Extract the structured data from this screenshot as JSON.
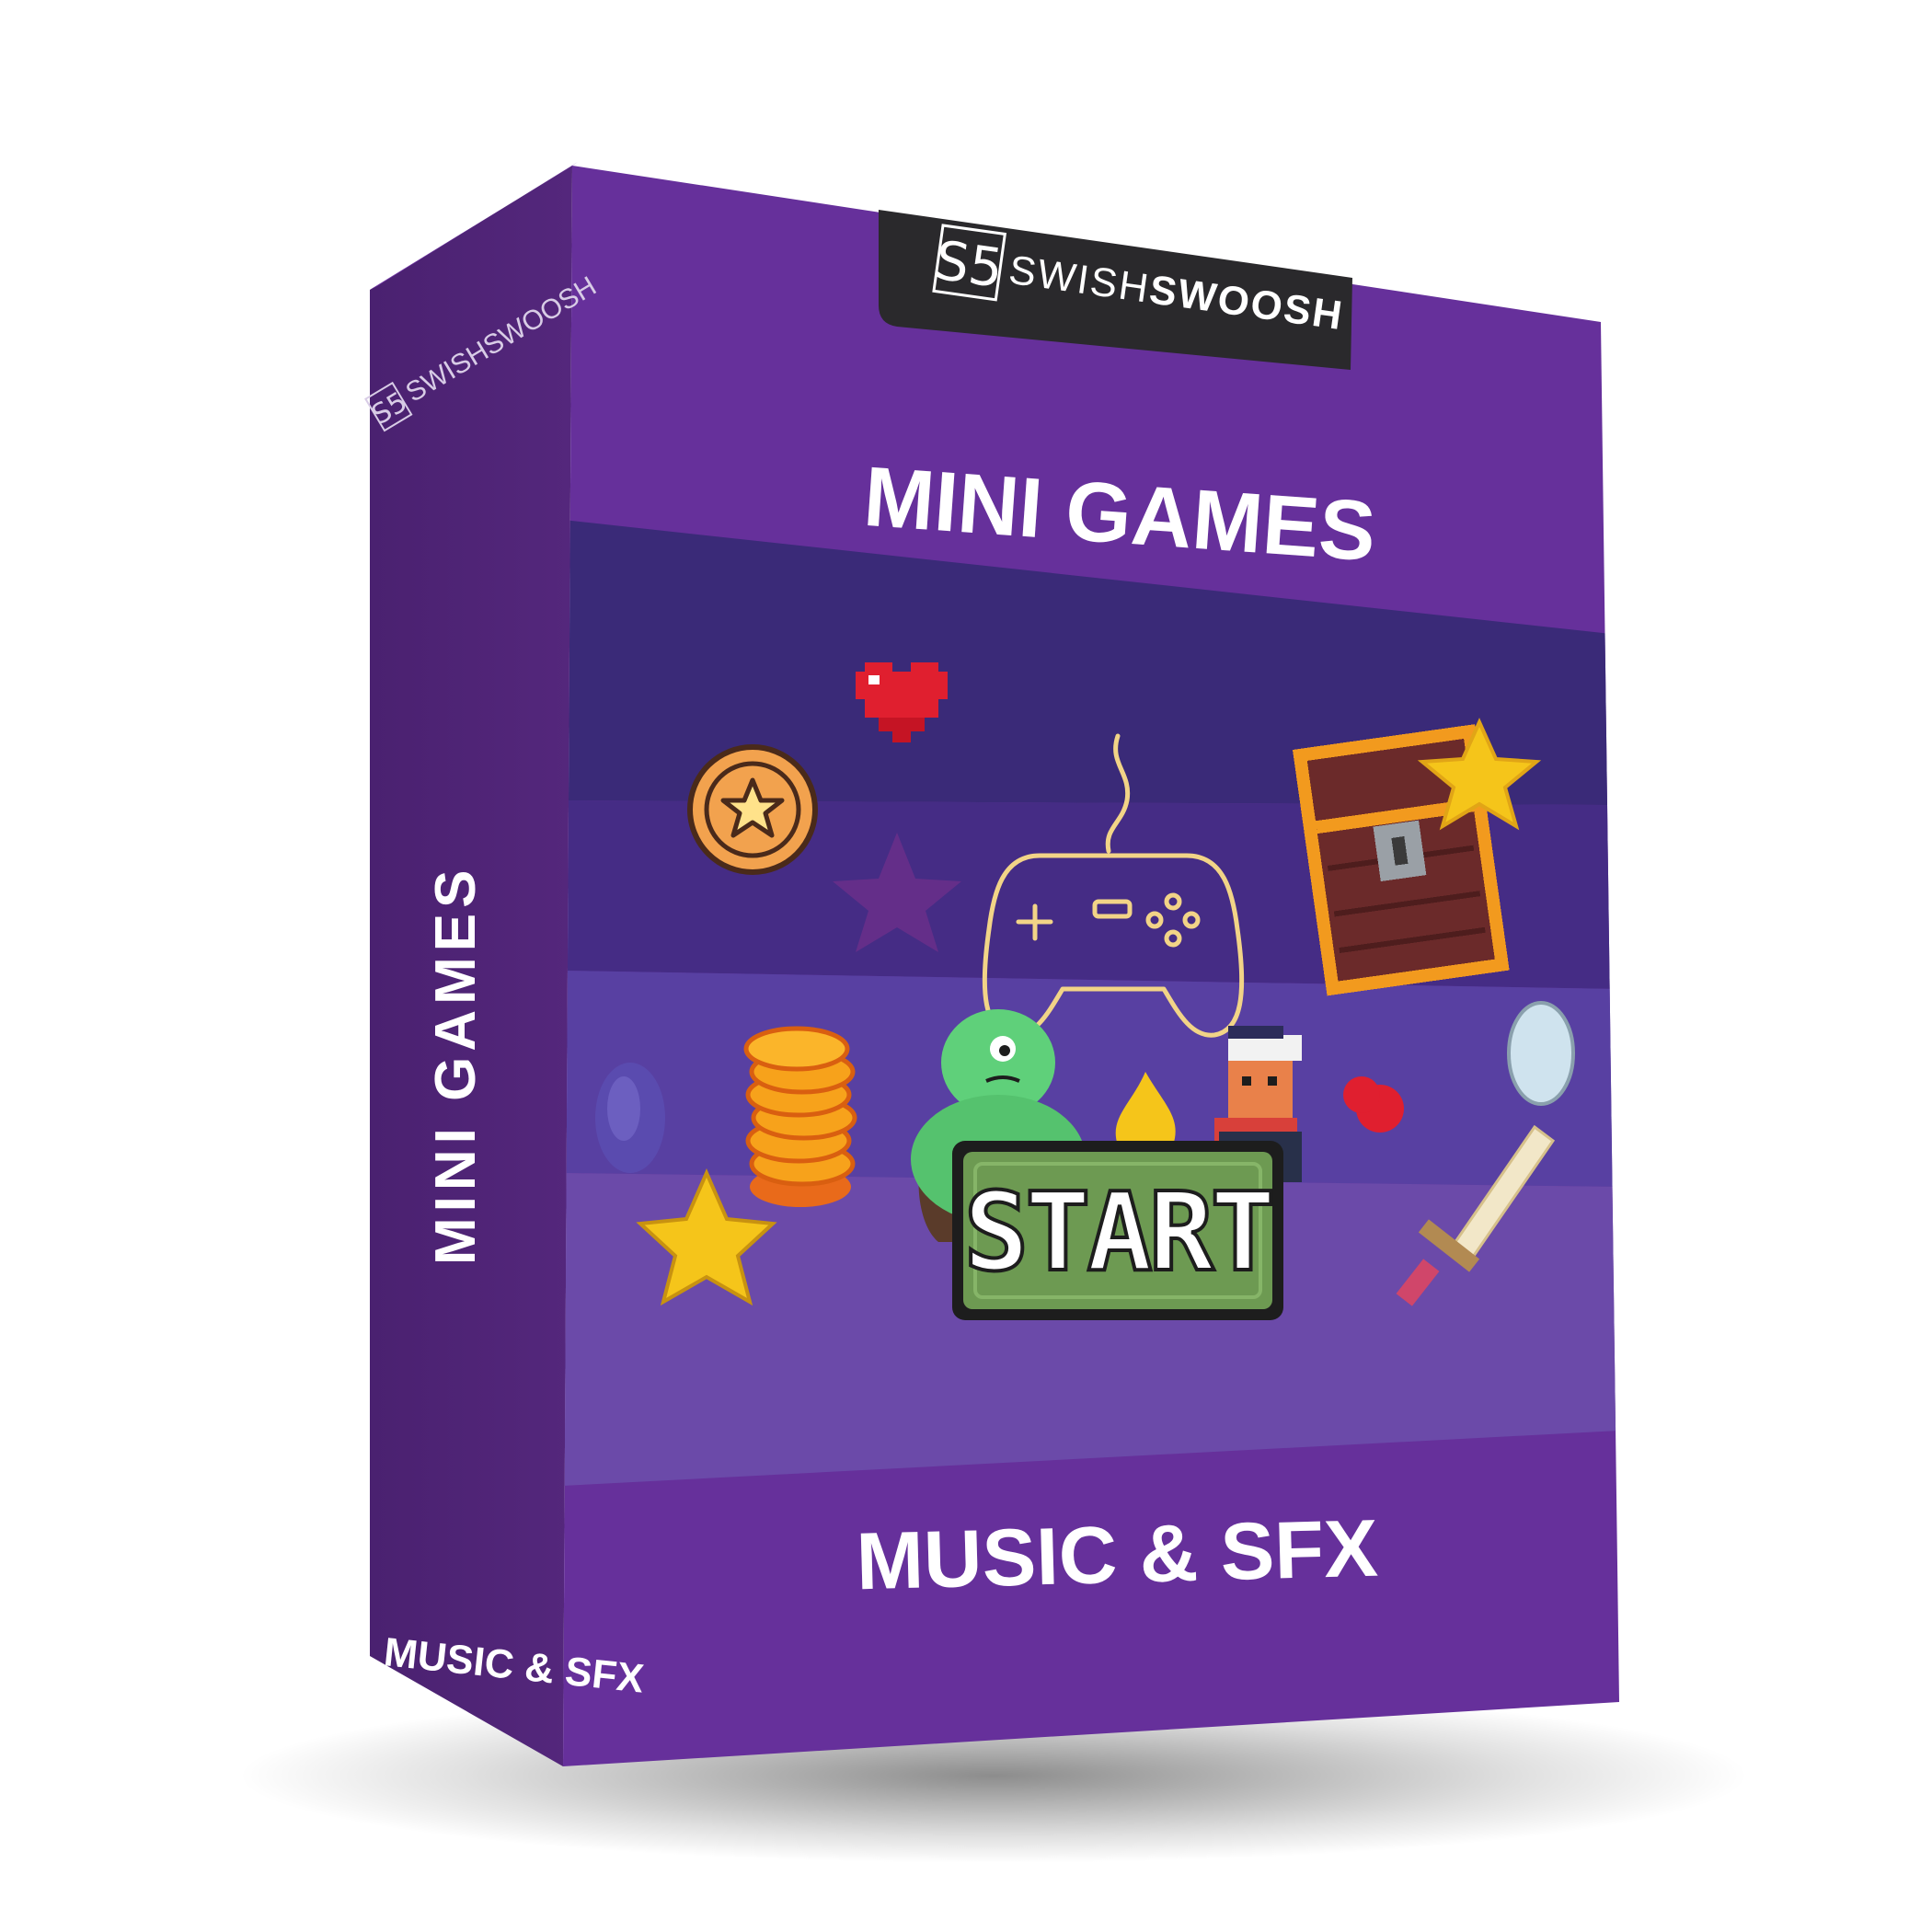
{
  "brand": {
    "name_light": "SWISH",
    "name_bold": "SWOOSH",
    "logo_mark": "S5"
  },
  "front": {
    "title": "MINI GAMES",
    "subtitle": "MUSIC & SFX",
    "start_label": "START"
  },
  "spine": {
    "title": "MINI GAMES",
    "subtitle": "MUSIC & SFX"
  },
  "colors": {
    "front_purple": "#66309b",
    "spine_purple": "#4e2474",
    "band_dark": "#3a2a78",
    "band_mid": "#452c85",
    "band_light": "#5840a2",
    "band_lighter": "#6b4aa9",
    "brand_tab": "#2a292c",
    "start_green": "#6d9a52"
  },
  "icons": [
    "coin-star-icon",
    "heart-icon",
    "game-controller-icon",
    "treasure-chest-icon",
    "star-icon",
    "coin-stack-icon",
    "gem-icon",
    "ogre-icon",
    "flame-icon",
    "player-character-icon",
    "sword-icon"
  ]
}
